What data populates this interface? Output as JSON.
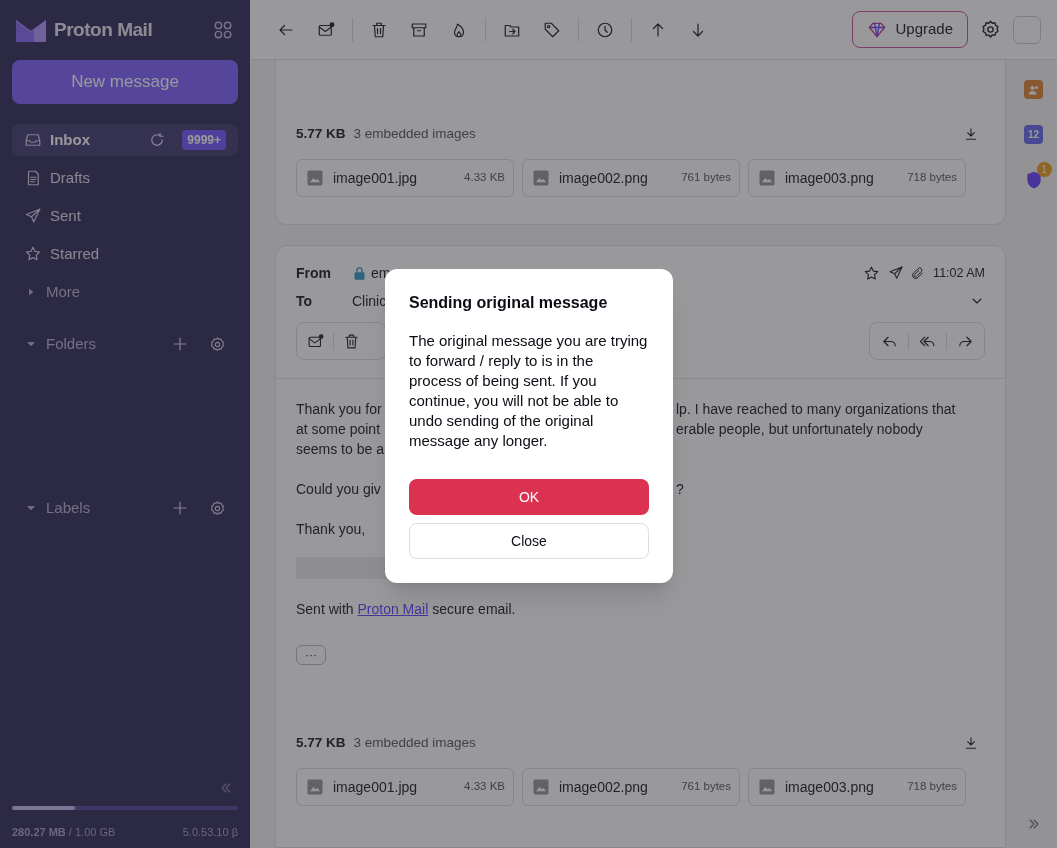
{
  "sidebar": {
    "brand": "Proton Mail",
    "new_message": "New message",
    "items": [
      {
        "label": "Inbox",
        "selected": true,
        "badge": "9999+"
      },
      {
        "label": "Drafts",
        "selected": false
      },
      {
        "label": "Sent",
        "selected": false
      },
      {
        "label": "Starred",
        "selected": false
      },
      {
        "label": "More",
        "selected": false
      }
    ],
    "sections": [
      {
        "label": "Folders",
        "expanded": true
      },
      {
        "label": "Labels",
        "expanded": true
      }
    ],
    "storage": {
      "used": "280.27 MB",
      "total": "/ 1.00 GB",
      "level": 0.28
    },
    "version": "5.0.53.10 β"
  },
  "toolbar": {
    "upgrade": "Upgrade"
  },
  "messages": [
    {
      "attachments": {
        "size": "5.77 KB",
        "summary": "3 embedded images",
        "files": [
          {
            "name": "image001.jpg",
            "size": "4.33 KB"
          },
          {
            "name": "image002.png",
            "size": "761 bytes"
          },
          {
            "name": "image003.png",
            "size": "718 bytes"
          }
        ]
      }
    },
    {
      "from_label": "From",
      "from": "em",
      "to_label": "To",
      "to": "Clinic",
      "time": "11:02 AM",
      "body": [
        {
          "lines": [
            {
              "left": "Thank you for",
              "right": "lp. I have reached to many organizations that"
            },
            {
              "left": "at some point",
              "right": "erable people, but unfortunately nobody"
            },
            {
              "left": "seems to be a"
            }
          ]
        },
        {
          "lines": [
            {
              "left": "Could you giv",
              "right": "?"
            }
          ]
        },
        {
          "lines": [
            {
              "left": "Thank you,"
            }
          ]
        }
      ],
      "signature": {
        "before": "Sent with ",
        "link": "Proton Mail",
        "after": " secure email."
      },
      "more": "···",
      "attachments": {
        "size": "5.77 KB",
        "summary": "3 embedded images",
        "files": [
          {
            "name": "image001.jpg",
            "size": "4.33 KB"
          },
          {
            "name": "image002.png",
            "size": "761 bytes"
          },
          {
            "name": "image003.png",
            "size": "718 bytes"
          }
        ]
      }
    }
  ],
  "rail": {
    "calendar_day": "12",
    "security_badge": "1"
  },
  "dialog": {
    "title": "Sending original message",
    "text": "The original message you are trying to forward / reply to is in the process of being sent. If you continue, you will not be able to undo sending of the original message any longer.",
    "ok": "OK",
    "close": "Close"
  }
}
